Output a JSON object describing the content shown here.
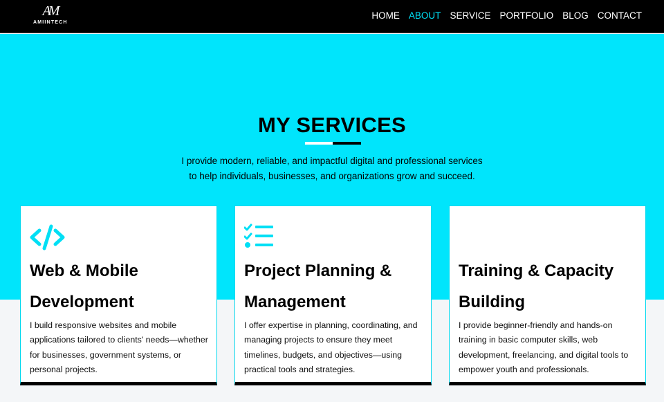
{
  "brand": {
    "logo_mark": "AM",
    "logo_text": "AMIINTECH"
  },
  "nav": {
    "items": [
      {
        "label": "HOME",
        "active": false
      },
      {
        "label": "ABOUT",
        "active": true
      },
      {
        "label": "SERVICE",
        "active": false
      },
      {
        "label": "PORTFOLIO",
        "active": false
      },
      {
        "label": "BLOG",
        "active": false
      },
      {
        "label": "CONTACT",
        "active": false
      }
    ]
  },
  "services": {
    "title": "MY SERVICES",
    "intro_line1": "I provide modern, reliable, and impactful digital and professional services",
    "intro_line2": "to help individuals, businesses, and organizations grow and succeed.",
    "cards": [
      {
        "icon": "code-icon",
        "title_line1": "Web & Mobile",
        "title_line2": "Development",
        "description": "I build responsive websites and mobile applications tailored to clients' needs—whether for businesses, government systems, or personal projects."
      },
      {
        "icon": "task-list-icon",
        "title_line1": "Project Planning &",
        "title_line2": "Management",
        "description": "I offer expertise in planning, coordinating, and managing projects to ensure they meet timelines, budgets, and objectives—using practical tools and strategies."
      },
      {
        "icon": "",
        "title_line1": "Training & Capacity",
        "title_line2": "Building",
        "description": "I provide beginner-friendly and hands-on training in basic computer skills, web development, freelancing, and digital tools to empower youth and professionals."
      }
    ]
  },
  "colors": {
    "accent": "#00e5fc",
    "nav_bg": "#000000",
    "active_link": "#00e3f8"
  }
}
